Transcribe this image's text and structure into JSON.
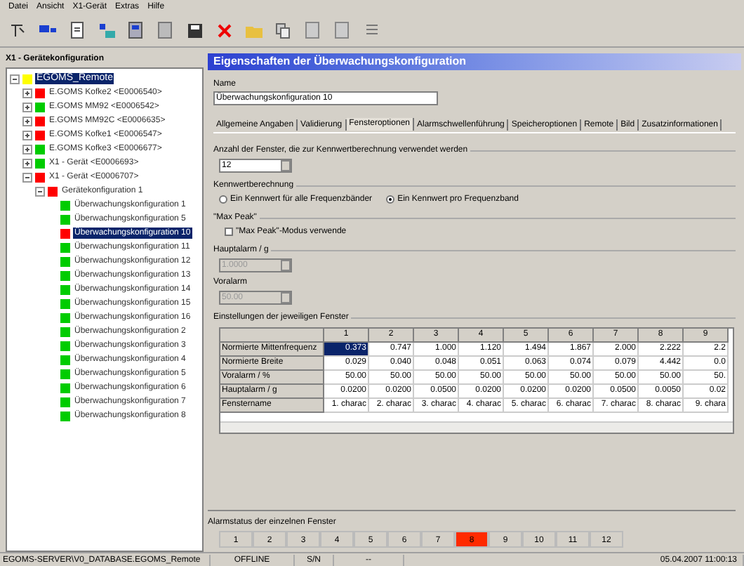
{
  "menu": [
    "Datei",
    "Ansicht",
    "X1-Gerät",
    "Extras",
    "Hilfe"
  ],
  "tree": {
    "title": "X1 - Gerätekonfiguration",
    "items": [
      {
        "label": "EGOMS_Remote",
        "color": "#ffff00",
        "selected": true,
        "expanded": true,
        "children": [
          {
            "label": "E.GOMS Kofke2 <E0006540>",
            "color": "#ff0000",
            "selected": false,
            "expanded": false
          },
          {
            "label": "E.GOMS MM92 <E0006542>",
            "color": "#00cc00",
            "selected": false,
            "expanded": false
          },
          {
            "label": "E.GOMS MM92C <E0006635>",
            "color": "#ff0000",
            "selected": false,
            "expanded": false
          },
          {
            "label": "E.GOMS Kofke1 <E0006547>",
            "color": "#ff0000",
            "selected": false,
            "expanded": false
          },
          {
            "label": "E.GOMS Kofke3 <E0006677>",
            "color": "#00cc00",
            "selected": false,
            "expanded": false
          },
          {
            "label": "X1 - Gerät <E0006693>",
            "color": "#00cc00",
            "selected": false,
            "expanded": false
          },
          {
            "label": "X1 - Gerät <E0006707>",
            "color": "#ff0000",
            "selected": false,
            "expanded": true,
            "children": [
              {
                "label": "Gerätekonfiguration 1",
                "color": "#ff0000",
                "selected": false,
                "expanded": true,
                "children": [
                  {
                    "label": "Überwachungskonfiguration 1",
                    "color": "#00cc00",
                    "selected": false
                  },
                  {
                    "label": "Überwachungskonfiguration 5",
                    "color": "#00cc00",
                    "selected": false
                  },
                  {
                    "label": "Überwachungskonfiguration 10",
                    "color": "#ff0000",
                    "selected": true
                  },
                  {
                    "label": "Überwachungskonfiguration 11",
                    "color": "#00cc00",
                    "selected": false
                  },
                  {
                    "label": "Überwachungskonfiguration 12",
                    "color": "#00cc00",
                    "selected": false
                  },
                  {
                    "label": "Überwachungskonfiguration 13",
                    "color": "#00cc00",
                    "selected": false
                  },
                  {
                    "label": "Überwachungskonfiguration 14",
                    "color": "#00cc00",
                    "selected": false
                  },
                  {
                    "label": "Überwachungskonfiguration 15",
                    "color": "#00cc00",
                    "selected": false
                  },
                  {
                    "label": "Überwachungskonfiguration 16",
                    "color": "#00cc00",
                    "selected": false
                  },
                  {
                    "label": "Überwachungskonfiguration 2",
                    "color": "#00cc00",
                    "selected": false
                  },
                  {
                    "label": "Überwachungskonfiguration 3",
                    "color": "#00cc00",
                    "selected": false
                  },
                  {
                    "label": "Überwachungskonfiguration 4",
                    "color": "#00cc00",
                    "selected": false
                  },
                  {
                    "label": "Überwachungskonfiguration 5",
                    "color": "#00cc00",
                    "selected": false
                  },
                  {
                    "label": "Überwachungskonfiguration 6",
                    "color": "#00cc00",
                    "selected": false
                  },
                  {
                    "label": "Überwachungskonfiguration 7",
                    "color": "#00cc00",
                    "selected": false
                  },
                  {
                    "label": "Überwachungskonfiguration 8",
                    "color": "#00cc00",
                    "selected": false
                  }
                ]
              }
            ]
          }
        ]
      }
    ]
  },
  "panel": {
    "title": "Eigenschaften der Überwachungskonfiguration",
    "name_label": "Name",
    "name_value": "Überwachungskonfiguration 10",
    "tabs": [
      {
        "label": "Allgemeine Angaben",
        "selected": false
      },
      {
        "label": "Validierung",
        "selected": false
      },
      {
        "label": "Fensteroptionen",
        "selected": true
      },
      {
        "label": "Alarmschwellenführung",
        "selected": false
      },
      {
        "label": "Speicheroptionen",
        "selected": false
      },
      {
        "label": "Remote",
        "selected": false
      },
      {
        "label": "Bild",
        "selected": false
      },
      {
        "label": "Zusatzinformationen",
        "selected": false
      }
    ],
    "window_count_label": "Anzahl der Fenster, die zur Kennwertberechnung verwendet werden",
    "window_count": "12",
    "calc_label": "Kennwertberechnung",
    "calc_options": [
      {
        "label": "Ein Kennwert für alle Frequenzbänder",
        "selected": false
      },
      {
        "label": "Ein Kennwert pro Frequenzband",
        "selected": true
      }
    ],
    "maxpeak_label": "\"Max Peak\"",
    "maxpeak_checkbox": {
      "label": "\"Max Peak\"-Modus verwende",
      "checked": false
    },
    "main_alarm_label": "Hauptalarm / g",
    "main_alarm": "1.0000",
    "main_alarm_disabled": true,
    "pre_alarm_label": "Voralarm",
    "pre_alarm": "50.00",
    "pre_alarm_disabled": true,
    "table_label": "Einstellungen der jeweiligen Fenster",
    "table": {
      "columns": [
        "1",
        "2",
        "3",
        "4",
        "5",
        "6",
        "7",
        "8",
        "9"
      ],
      "rows": [
        {
          "label": "Normierte Mittenfrequenz",
          "cells": [
            "0.373",
            "0.747",
            "1.000",
            "1.120",
            "1.494",
            "1.867",
            "2.000",
            "2.222",
            "2.2"
          ],
          "cells_selected": [
            true,
            false,
            false,
            false,
            false,
            false,
            false,
            false,
            false
          ]
        },
        {
          "label": "Normierte Breite",
          "cells": [
            "0.029",
            "0.040",
            "0.048",
            "0.051",
            "0.063",
            "0.074",
            "0.079",
            "4.442",
            "0.0"
          ]
        },
        {
          "label": "Voralarm / %",
          "cells": [
            "50.00",
            "50.00",
            "50.00",
            "50.00",
            "50.00",
            "50.00",
            "50.00",
            "50.00",
            "50."
          ]
        },
        {
          "label": "Hauptalarm / g",
          "cells": [
            "0.0200",
            "0.0200",
            "0.0500",
            "0.0200",
            "0.0200",
            "0.0200",
            "0.0500",
            "0.0050",
            "0.02"
          ]
        },
        {
          "label": "Fenstername",
          "cells": [
            "1. charac",
            "2. charac",
            "3. charac",
            "4. charac",
            "5. charac",
            "6. charac",
            "7. charac",
            "8. charac",
            "9. chara"
          ]
        }
      ]
    },
    "alarm_label": "Alarmstatus der einzelnen Fenster",
    "alarms": [
      {
        "label": "1",
        "alarm": false
      },
      {
        "label": "2",
        "alarm": false
      },
      {
        "label": "3",
        "alarm": false
      },
      {
        "label": "4",
        "alarm": false
      },
      {
        "label": "5",
        "alarm": false
      },
      {
        "label": "6",
        "alarm": false
      },
      {
        "label": "7",
        "alarm": false
      },
      {
        "label": "8",
        "alarm": true
      },
      {
        "label": "9",
        "alarm": false
      },
      {
        "label": "10",
        "alarm": false
      },
      {
        "label": "11",
        "alarm": false
      },
      {
        "label": "12",
        "alarm": false
      }
    ]
  },
  "status_bar": [
    "EGOMS-SERVER\\V0_DATABASE.EGOMS_Remote",
    "OFFLINE",
    "S/N",
    "--",
    "05.04.2007 11:00:13"
  ]
}
